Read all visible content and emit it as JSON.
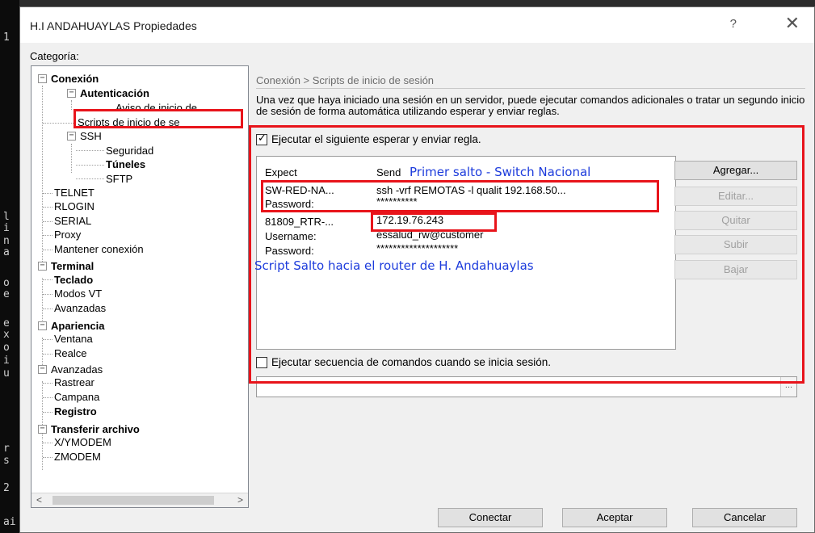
{
  "background": {
    "terminal_chars": [
      "1",
      "l",
      "i",
      "n",
      "a",
      "o",
      "e",
      "e",
      "x",
      "o",
      "i",
      "u",
      "r",
      "s",
      "2",
      "ai"
    ]
  },
  "window": {
    "title": "H.I ANDAHUAYLAS Propiedades",
    "help_glyph": "?",
    "close_glyph": "✕"
  },
  "sidebar": {
    "label": "Categoría:",
    "items": [
      {
        "label": "Conexión",
        "bold": true
      },
      {
        "label": "Autenticación",
        "bold": true
      },
      {
        "label": "Aviso de inicio de",
        "bold": false
      },
      {
        "label": "Scripts de inicio de se",
        "bold": false
      },
      {
        "label": "SSH",
        "bold": false
      },
      {
        "label": "Seguridad",
        "bold": false
      },
      {
        "label": "Túneles",
        "bold": true
      },
      {
        "label": "SFTP",
        "bold": false
      },
      {
        "label": "TELNET",
        "bold": false
      },
      {
        "label": "RLOGIN",
        "bold": false
      },
      {
        "label": "SERIAL",
        "bold": false
      },
      {
        "label": "Proxy",
        "bold": false
      },
      {
        "label": "Mantener conexión",
        "bold": false
      },
      {
        "label": "Terminal",
        "bold": true
      },
      {
        "label": "Teclado",
        "bold": true
      },
      {
        "label": "Modos VT",
        "bold": false
      },
      {
        "label": "Avanzadas",
        "bold": false
      },
      {
        "label": "Apariencia",
        "bold": true
      },
      {
        "label": "Ventana",
        "bold": false
      },
      {
        "label": "Realce",
        "bold": false
      },
      {
        "label": "Avanzadas",
        "bold": false
      },
      {
        "label": "Rastrear",
        "bold": false
      },
      {
        "label": "Campana",
        "bold": false
      },
      {
        "label": "Registro",
        "bold": true
      },
      {
        "label": "Transferir archivo",
        "bold": true
      },
      {
        "label": "X/YMODEM",
        "bold": false
      },
      {
        "label": "ZMODEM",
        "bold": false
      }
    ],
    "scroll_left": "<",
    "scroll_right": ">"
  },
  "main": {
    "header": "Conexión > Scripts de inicio de sesión",
    "description": "Una vez que haya iniciado una sesión en un servidor, puede ejecutar comandos adicionales o tratar un segundo inicio de sesión de forma automática utilizando esperar y enviar reglas.",
    "expect_checkbox_label": "Ejecutar el siguiente esperar y enviar regla.",
    "expect_checked": true,
    "columns": [
      "Expect",
      "Send"
    ],
    "rows": [
      {
        "expect": "SW-RED-NA...",
        "send": "ssh -vrf REMOTAS -l qualit 192.168.50..."
      },
      {
        "expect": "Password:",
        "send": "**********"
      },
      {
        "expect": "81809_RTR-...",
        "send": "172.19.76.243"
      },
      {
        "expect": "Username:",
        "send": "essalud_rw@customer"
      },
      {
        "expect": "Password:",
        "send": "********************"
      }
    ],
    "side_buttons": [
      "Agregar...",
      "Editar...",
      "Quitar",
      "Subir",
      "Bajar"
    ],
    "commands_checkbox_label": "Ejecutar secuencia de comandos cuando se inicia sesión.",
    "commands_checked": false,
    "browse_label": "..."
  },
  "annotations": {
    "first_hop": "Primer salto - Switch Nacional",
    "router_hop": "Script Salto hacia el router de H. Andahuaylas",
    "color": "#1c3bdc",
    "highlight_color": "#e8141b"
  },
  "footer": {
    "connect": "Conectar",
    "accept": "Aceptar",
    "cancel": "Cancelar"
  }
}
